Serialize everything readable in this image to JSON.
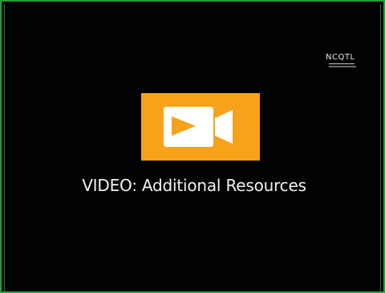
{
  "slide": {
    "logo_text": "NCQTL",
    "title": "VIDEO: Additional Resources"
  },
  "colors": {
    "background": "#020202",
    "frame_border": "#1fa13a",
    "video_tile": "#f6a21a",
    "title_text": "#f2f2f2"
  },
  "icons": {
    "video": "video-camera-icon"
  }
}
